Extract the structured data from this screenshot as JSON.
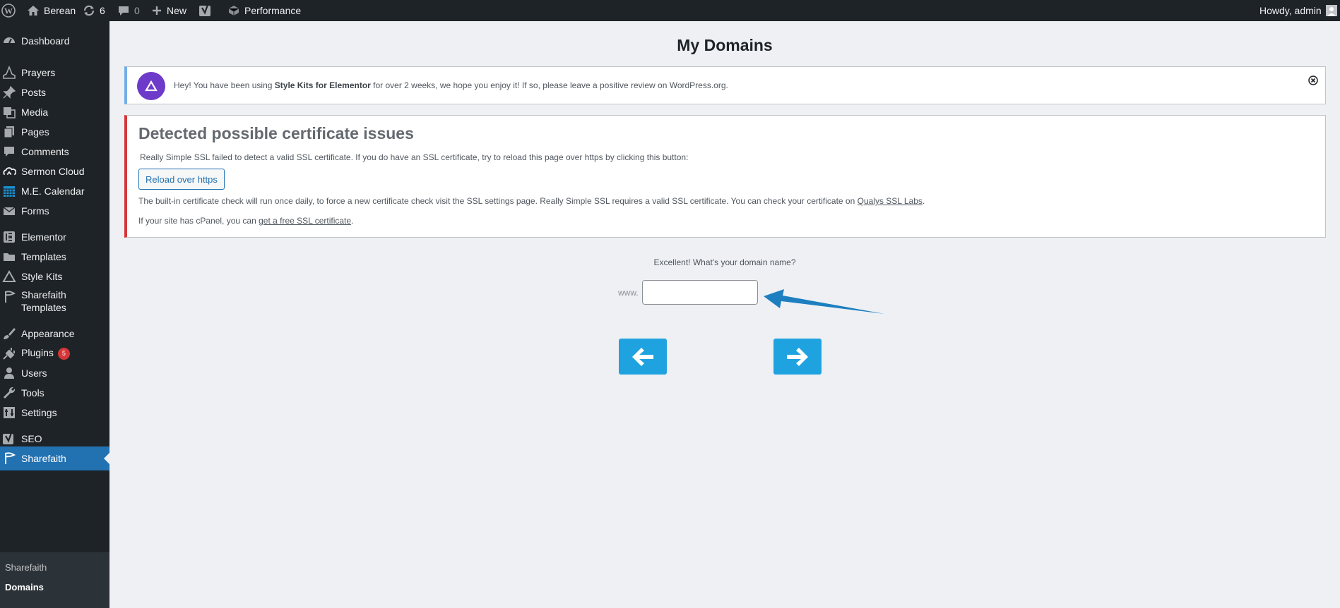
{
  "adminbar": {
    "site_name": "Berean",
    "updates_count": "6",
    "comments_count": "0",
    "new_label": "New",
    "performance_label": "Performance",
    "greeting": "Howdy, admin"
  },
  "sidebar": {
    "items": [
      {
        "label": "Dashboard",
        "icon": "dashboard-icon"
      },
      {
        "label": "Prayers",
        "icon": "prayers-icon"
      },
      {
        "label": "Posts",
        "icon": "pin-icon"
      },
      {
        "label": "Media",
        "icon": "media-icon"
      },
      {
        "label": "Pages",
        "icon": "pages-icon"
      },
      {
        "label": "Comments",
        "icon": "comment-icon"
      },
      {
        "label": "Sermon Cloud",
        "icon": "cloud-icon"
      },
      {
        "label": "M.E. Calendar",
        "icon": "calendar-icon"
      },
      {
        "label": "Forms",
        "icon": "mail-icon"
      },
      {
        "label": "Elementor",
        "icon": "elementor-icon"
      },
      {
        "label": "Templates",
        "icon": "folder-icon"
      },
      {
        "label": "Style Kits",
        "icon": "triangle-icon"
      },
      {
        "label": "Sharefaith Templates",
        "icon": "sharefaith-icon"
      },
      {
        "label": "Appearance",
        "icon": "brush-icon"
      },
      {
        "label": "Plugins",
        "icon": "plug-icon",
        "badge": "5"
      },
      {
        "label": "Users",
        "icon": "user-icon"
      },
      {
        "label": "Tools",
        "icon": "wrench-icon"
      },
      {
        "label": "Settings",
        "icon": "settings-icon"
      },
      {
        "label": "SEO",
        "icon": "yoast-icon"
      },
      {
        "label": "Sharefaith",
        "icon": "sharefaith-icon"
      }
    ],
    "submenu": [
      "Sharefaith",
      "Domains"
    ]
  },
  "page": {
    "title": "My Domains"
  },
  "stylekits_notice": {
    "prefix": "Hey! You have been using ",
    "product": "Style Kits for Elementor",
    "suffix": " for over 2 weeks, we hope you enjoy it! If so, please leave a positive review on WordPress.org."
  },
  "ssl_notice": {
    "title": "Detected possible certificate issues",
    "line1": "Really Simple SSL failed to detect a valid SSL certificate. If you do have an SSL certificate, try to reload this page over https by clicking this button:",
    "reload_button": "Reload over https",
    "line2_text": "The built-in certificate check will run once daily, to force a new certificate check visit the SSL settings page. Really Simple SSL requires a valid SSL certificate. You can check your certificate on ",
    "line2_link": "Qualys SSL Labs",
    "line2_end": ".",
    "line3_text": "If your site has cPanel, you can ",
    "line3_link": "get a free SSL certificate",
    "line3_end": "."
  },
  "domain_form": {
    "prompt": "Excellent! What's your domain name?",
    "prefix": "www.",
    "value": ""
  },
  "colors": {
    "accent": "#2271b1",
    "nav_button": "#1fa3e0",
    "error_border": "#d63638",
    "info_border": "#72aee6",
    "stylekits_purple": "#6d3ac9"
  }
}
